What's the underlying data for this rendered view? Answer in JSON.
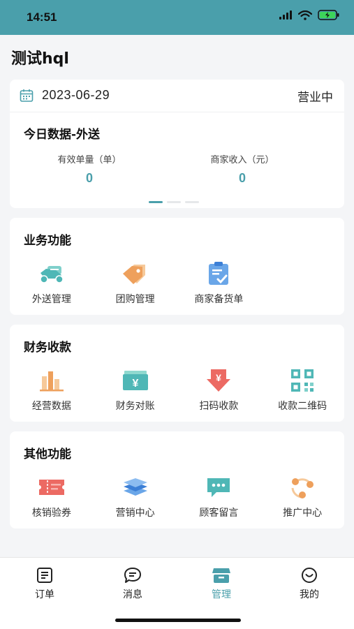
{
  "status_bar": {
    "time": "14:51"
  },
  "header": {
    "title": "测试hql"
  },
  "summary": {
    "date": "2023-06-29",
    "business_status": "营业中",
    "section_title": "今日数据-外送",
    "stats": [
      {
        "label": "有效单量（单）",
        "value": "0"
      },
      {
        "label": "商家收入（元）",
        "value": "0"
      }
    ]
  },
  "business": {
    "title": "业务功能",
    "items": [
      {
        "label": "外送管理",
        "icon": "scooter-icon"
      },
      {
        "label": "团购管理",
        "icon": "tag-icon"
      },
      {
        "label": "商家备货单",
        "icon": "clipboard-check-icon"
      }
    ]
  },
  "finance": {
    "title": "财务收款",
    "items": [
      {
        "label": "经营数据",
        "icon": "bar-chart-icon"
      },
      {
        "label": "财务对账",
        "icon": "yuan-bill-icon"
      },
      {
        "label": "扫码收款",
        "icon": "yuan-arrow-down-icon"
      },
      {
        "label": "收款二维码",
        "icon": "qr-code-icon"
      }
    ]
  },
  "other": {
    "title": "其他功能",
    "items": [
      {
        "label": "核销验券",
        "icon": "coupon-icon"
      },
      {
        "label": "营销中心",
        "icon": "layers-icon"
      },
      {
        "label": "顾客留言",
        "icon": "chat-bubble-icon"
      },
      {
        "label": "推广中心",
        "icon": "share-nodes-icon"
      }
    ]
  },
  "tabs": [
    {
      "label": "订单",
      "icon": "order-list-icon"
    },
    {
      "label": "消息",
      "icon": "message-icon"
    },
    {
      "label": "管理",
      "icon": "store-icon",
      "active": true
    },
    {
      "label": "我的",
      "icon": "smile-icon"
    }
  ],
  "colors": {
    "accent": "#4a9fab",
    "background": "#f4f5f7"
  }
}
